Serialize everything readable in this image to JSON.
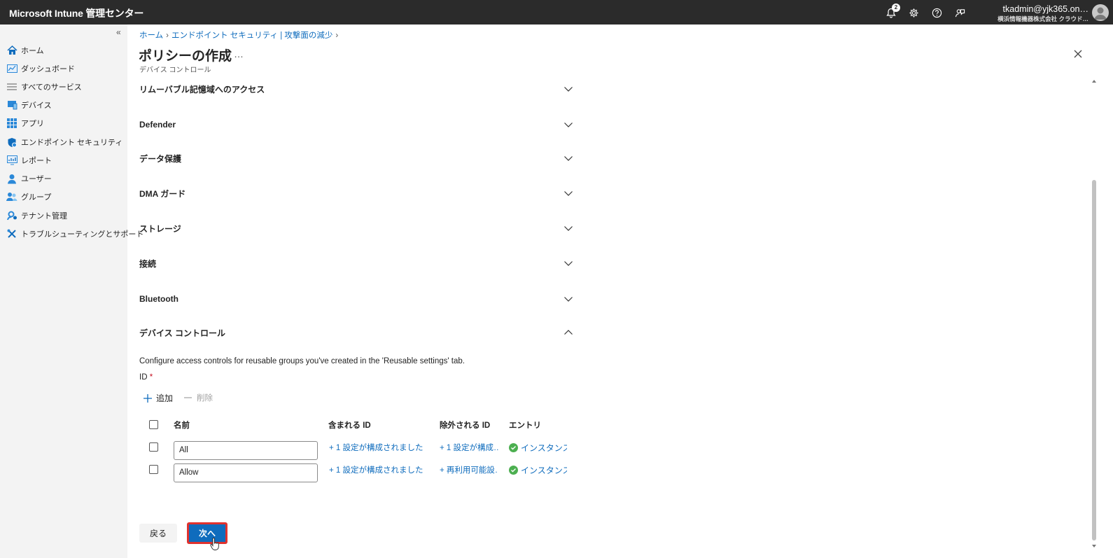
{
  "topbar": {
    "brand": "Microsoft Intune 管理センター",
    "notification_count": "2",
    "account_user": "tkadmin@yjk365.on…",
    "account_org": "横浜情報機器株式会社 クラウド…"
  },
  "sidebar": {
    "items": [
      {
        "label": "ホーム",
        "icon": "home-icon"
      },
      {
        "label": "ダッシュボード",
        "icon": "dashboard-icon"
      },
      {
        "label": "すべてのサービス",
        "icon": "list-icon"
      },
      {
        "label": "デバイス",
        "icon": "device-icon"
      },
      {
        "label": "アプリ",
        "icon": "apps-icon"
      },
      {
        "label": "エンドポイント セキュリティ",
        "icon": "shield-icon"
      },
      {
        "label": "レポート",
        "icon": "report-icon"
      },
      {
        "label": "ユーザー",
        "icon": "user-icon"
      },
      {
        "label": "グループ",
        "icon": "group-icon"
      },
      {
        "label": "テナント管理",
        "icon": "tenant-icon"
      },
      {
        "label": "トラブルシューティングとサポート",
        "icon": "tools-icon"
      }
    ]
  },
  "breadcrumb": {
    "home": "ホーム",
    "section": "エンドポイント セキュリティ | 攻撃面の減少"
  },
  "page": {
    "title": "ポリシーの作成",
    "more": "…",
    "subtitle": "デバイス コントロール"
  },
  "sections": [
    {
      "label": "リムーバブル記憶域へのアクセス",
      "expanded": false
    },
    {
      "label": "Defender",
      "expanded": false
    },
    {
      "label": "データ保護",
      "expanded": false
    },
    {
      "label": "DMA ガード",
      "expanded": false
    },
    {
      "label": "ストレージ",
      "expanded": false
    },
    {
      "label": "接続",
      "expanded": false
    },
    {
      "label": "Bluetooth",
      "expanded": false
    },
    {
      "label": "デバイス コントロール",
      "expanded": true
    }
  ],
  "device_control": {
    "description": "Configure access controls for reusable groups you've created in the 'Reusable settings' tab.",
    "id_label": "ID",
    "required_mark": "*",
    "add_label": "追加",
    "delete_label": "削除",
    "columns": [
      "名前",
      "含まれる ID",
      "除外される ID",
      "エントリ"
    ],
    "rows": [
      {
        "name": "All",
        "included": "+ 1 設定が構成されました",
        "excluded": "+ 1 設定が構成…",
        "entry": "インスタンスの"
      },
      {
        "name": "Allow",
        "included": "+ 1 設定が構成されました",
        "excluded": "+ 再利用可能設…",
        "entry": "インスタンスの"
      }
    ]
  },
  "footer": {
    "back_label": "戻る",
    "next_label": "次へ"
  },
  "colors": {
    "topbar": "#2b2b2b",
    "link": "#0f6cbd",
    "primary_button": "#0f6cbd",
    "highlight_border": "#e0322e",
    "success": "#4caf50"
  }
}
